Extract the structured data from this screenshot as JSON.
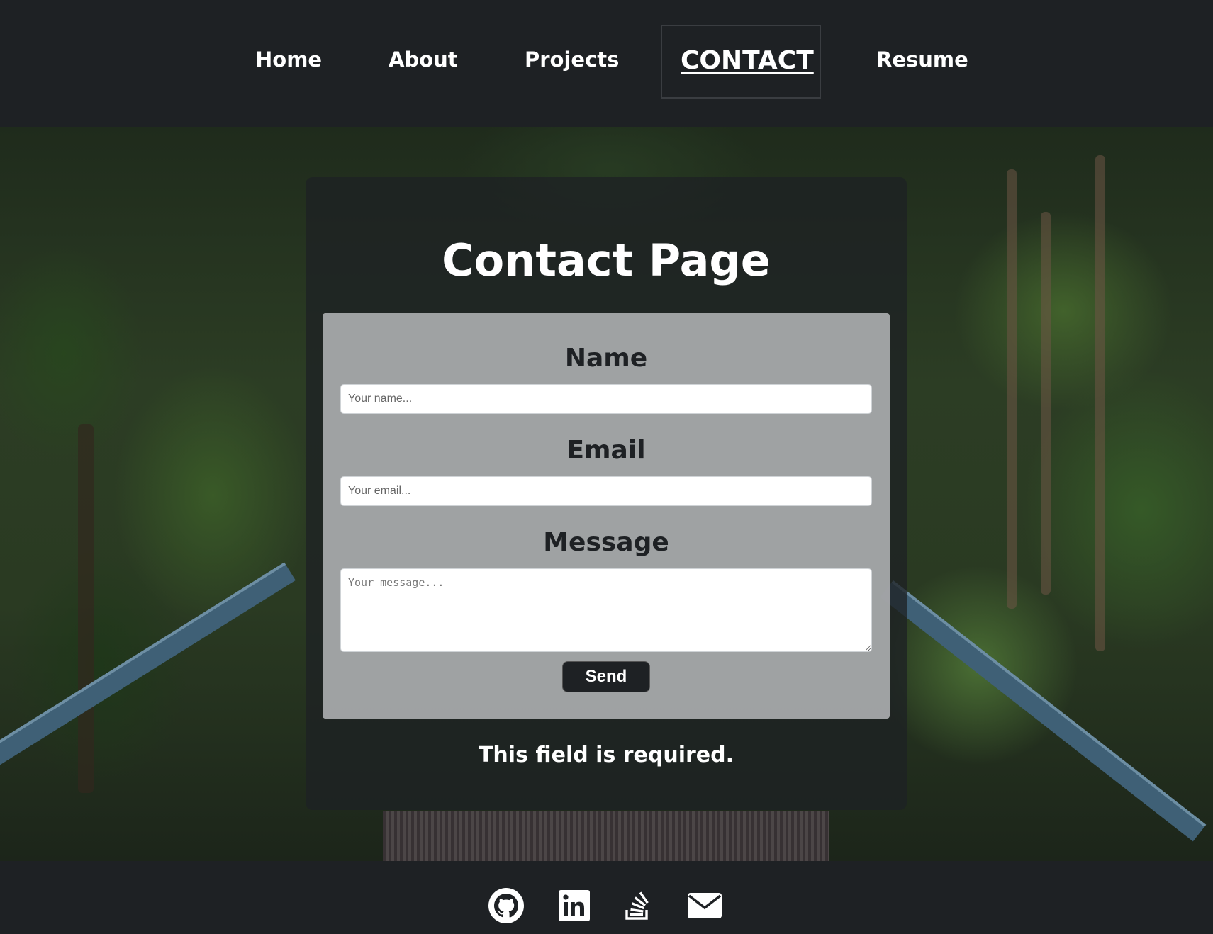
{
  "nav": {
    "items": [
      {
        "label": "Home"
      },
      {
        "label": "About"
      },
      {
        "label": "Projects"
      },
      {
        "label": "CONTACT"
      },
      {
        "label": "Resume"
      }
    ],
    "active": "CONTACT"
  },
  "main": {
    "title": "Contact Page",
    "form": {
      "name_label": "Name",
      "name_placeholder": "Your name...",
      "email_label": "Email",
      "email_placeholder": "Your email...",
      "message_label": "Message",
      "message_placeholder": "Your message...",
      "send_label": "Send"
    },
    "error": "This field is required."
  },
  "footer": {
    "icons": [
      "github-icon",
      "linkedin-icon",
      "stackoverflow-icon",
      "email-icon"
    ]
  },
  "colors": {
    "bar": "#1e2124",
    "text": "#ffffff",
    "panel": "#aaacaf"
  }
}
